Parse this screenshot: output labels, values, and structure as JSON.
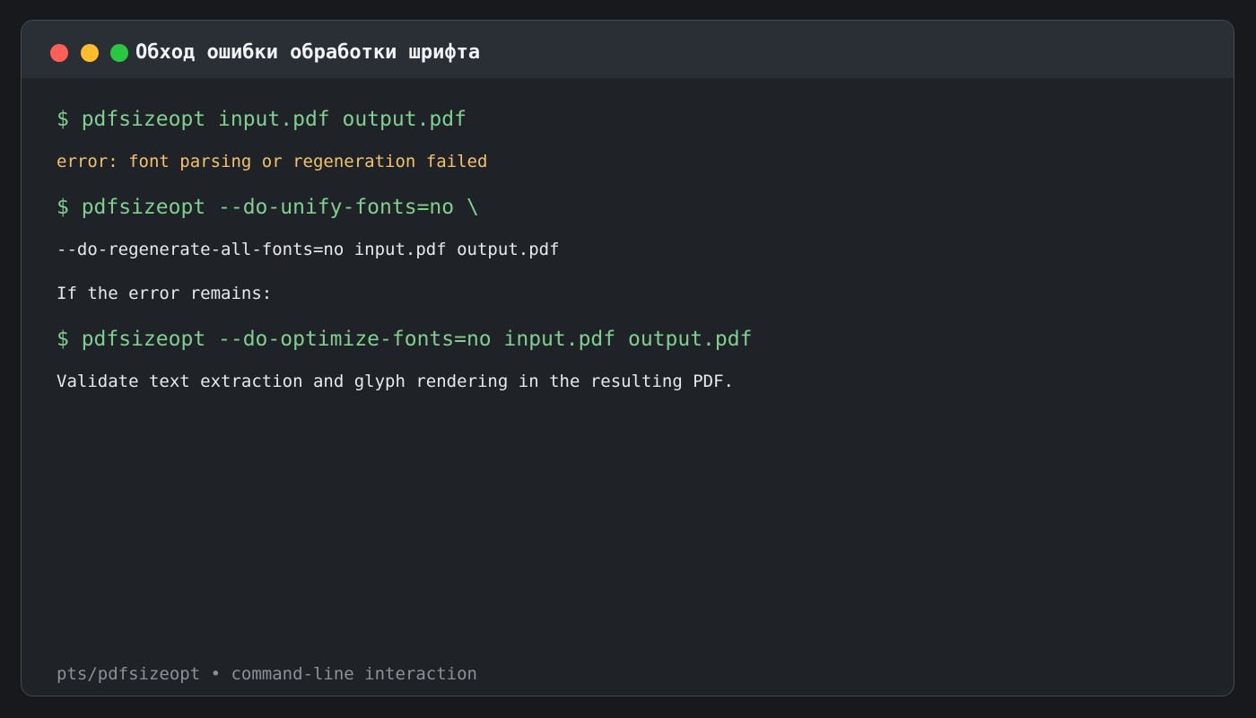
{
  "window": {
    "title": "Обход ошибки обработки шрифта",
    "controls": [
      "close",
      "minimize",
      "maximize"
    ]
  },
  "terminal": {
    "lines": [
      {
        "kind": "command",
        "text": "$ pdfsizeopt input.pdf output.pdf"
      },
      {
        "kind": "error",
        "text": "error: font parsing or regeneration failed"
      },
      {
        "kind": "command",
        "text": "$ pdfsizeopt --do-unify-fonts=no \\"
      },
      {
        "kind": "continuation",
        "text": "  --do-regenerate-all-fonts=no input.pdf output.pdf"
      },
      {
        "kind": "text",
        "text": "If the error remains:"
      },
      {
        "kind": "command",
        "text": "$ pdfsizeopt --do-optimize-fonts=no input.pdf output.pdf"
      },
      {
        "kind": "text",
        "text": "Validate text extraction and glyph rendering in the resulting PDF."
      }
    ],
    "footer": "pts/pdfsizeopt • command-line interaction"
  },
  "colors": {
    "page_bg": "#17191d",
    "window_bg": "#1f2227",
    "titlebar_bg": "#2a2e35",
    "command": "#7fcf8f",
    "error": "#f3c26e",
    "text": "#e7e9ec",
    "footer": "#8b9099",
    "close": "#ff5f57",
    "minimize": "#febc2e",
    "maximize": "#28c840"
  }
}
